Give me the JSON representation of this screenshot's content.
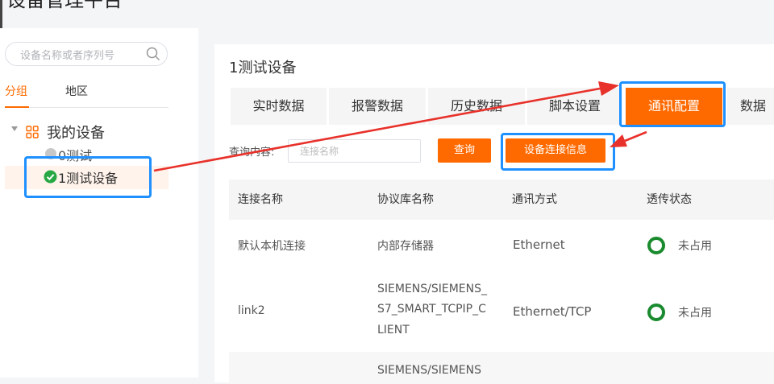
{
  "app": {
    "title": "设备管理平台"
  },
  "sidebar": {
    "search_placeholder": "设备名称或者序列号",
    "tabs": [
      {
        "label": "分组",
        "active": true
      },
      {
        "label": "地区",
        "active": false
      }
    ],
    "tree": {
      "root_label": "我的设备",
      "items": [
        {
          "label": "0测试",
          "status": "offline"
        },
        {
          "label": "1测试设备",
          "status": "online",
          "selected": true
        }
      ]
    }
  },
  "main": {
    "device_title": "1测试设备",
    "tabs": [
      {
        "label": "实时数据",
        "active": false
      },
      {
        "label": "报警数据",
        "active": false
      },
      {
        "label": "历史数据",
        "active": false
      },
      {
        "label": "脚本设置",
        "active": false
      },
      {
        "label": "通讯配置",
        "active": true
      },
      {
        "label": "数据",
        "active": false
      }
    ],
    "query": {
      "label": "查询内容:",
      "placeholder": "连接名称",
      "search_button": "查询",
      "info_button": "设备连接信息"
    },
    "table": {
      "columns": [
        "连接名称",
        "协议库名称",
        "通讯方式",
        "透传状态"
      ],
      "rows": [
        {
          "name": "默认本机连接",
          "protocol_lines": [
            "内部存储器"
          ],
          "comm": "Ethernet",
          "status": "未占用"
        },
        {
          "name": "link2",
          "protocol_lines": [
            "SIEMENS/SIEMENS_",
            "S7_SMART_TCPIP_C",
            "LIENT"
          ],
          "comm": "Ethernet/TCP",
          "status": "未占用"
        },
        {
          "name": "",
          "protocol_lines": [
            "SIEMENS/SIEMENS"
          ],
          "comm": "",
          "status": ""
        }
      ]
    }
  },
  "colors": {
    "accent": "#ff6a00",
    "highlight": "#1e90ff",
    "arrow": "#e8312a",
    "status_ok": "#1a8a2e"
  }
}
